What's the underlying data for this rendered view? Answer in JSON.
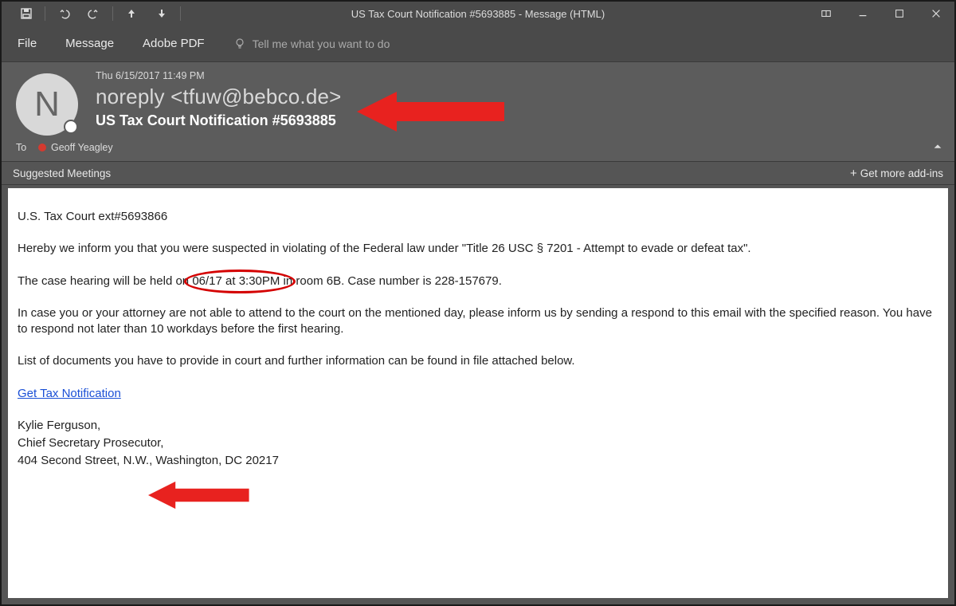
{
  "window": {
    "title": "US Tax Court Notification #5693885  -  Message (HTML)"
  },
  "qat": {
    "save": "Save",
    "undo": "Undo",
    "redo": "Redo",
    "prev": "Previous Item",
    "next": "Next Item"
  },
  "menu": {
    "file": "File",
    "message": "Message",
    "adobe": "Adobe PDF",
    "tellme": "Tell me what you want to do"
  },
  "header": {
    "avatar_initial": "N",
    "timestamp": "Thu 6/15/2017 11:49 PM",
    "from": "noreply <tfuw@bebco.de>",
    "subject": "US Tax Court Notification #5693885",
    "to_label": "To",
    "to_name": "Geoff Yeagley"
  },
  "suggested": {
    "label": "Suggested Meetings",
    "addins": "Get more add-ins"
  },
  "body": {
    "line1": "U.S. Tax Court ext#5693866",
    "line2": "Hereby we inform you that you were suspected in violating of the Federal law under \"Title 26 USC § 7201 - Attempt to evade or defeat tax\".",
    "line3a": "The case hearing will be held on ",
    "line3b": "06/17 at 3:30PM",
    "line3c": " in room 6B. Case number is 228-157679.",
    "line4": "In case you or your attorney are not able to attend to the court on the mentioned day, please inform us by sending a respond to this email with the specified reason. You have to respond not later than 10 workdays before the first hearing.",
    "line5": "List of documents you have to provide in court and further information can be found in file attached below.",
    "link": "Get Tax Notification",
    "sig_name": "Kylie Ferguson,",
    "sig_title": "Chief Secretary Prosecutor,",
    "sig_addr": "404 Second Street, N.W., Washington, DC 20217"
  },
  "annotations": {
    "arrow_color": "#e8221f",
    "circle_color": "#d40000"
  }
}
